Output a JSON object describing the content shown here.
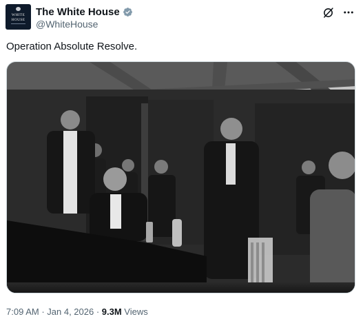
{
  "author": {
    "display_name": "The White House",
    "handle": "@WhiteHouse",
    "verified": true,
    "badge_color": "#829aab",
    "avatar_wordmark": [
      "THE",
      "WHITE",
      "HOUSE"
    ],
    "avatar_color": "#0e1a2b"
  },
  "header_icons": [
    "grok-icon",
    "more-icon"
  ],
  "post": {
    "text": "Operation Absolute Resolve.",
    "media_type": "black-and-white photograph"
  },
  "meta": {
    "time": "7:09 AM",
    "sep1": " · ",
    "date": "Jan 4, 2026",
    "sep2": " · ",
    "views_count": "9.3M",
    "views_label": " Views"
  },
  "colors": {
    "text_primary": "#0f1419",
    "text_secondary": "#536471",
    "border": "#cfd9de"
  }
}
